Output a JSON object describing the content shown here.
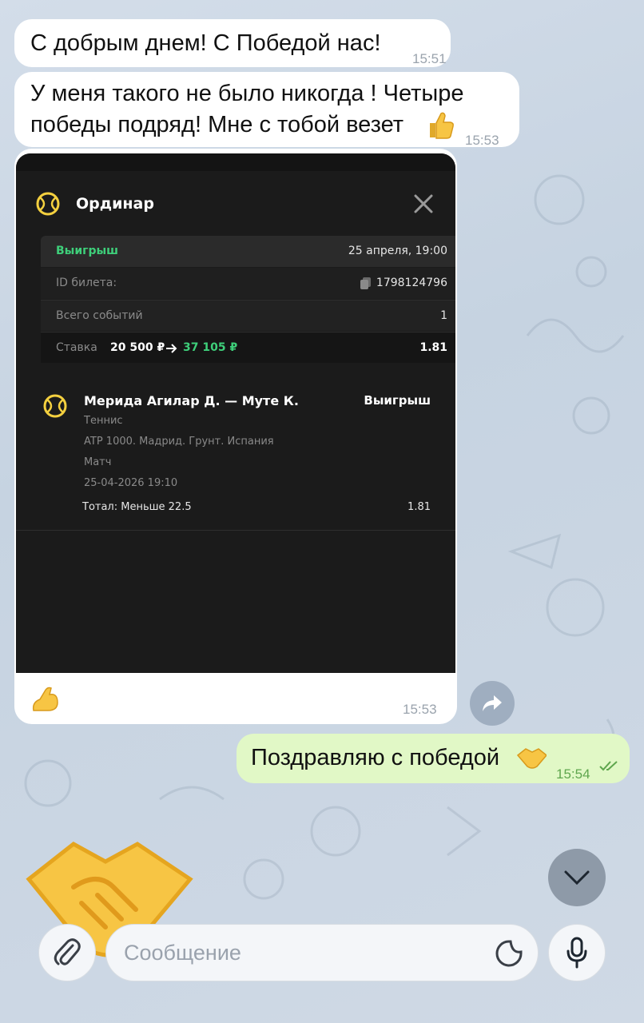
{
  "messages": {
    "m1": {
      "text": "С добрым днем! С Победой нас!",
      "time": "15:51"
    },
    "m2": {
      "line1": "У меня такого не было никогда ! Четыре",
      "line2": "победы подряд! Мне с тобой везет",
      "time": "15:53"
    },
    "photo_msg": {
      "time": "15:53"
    },
    "m4": {
      "text": "Поздравляю с победой",
      "time": "15:54"
    }
  },
  "ticket": {
    "title": "Ординар",
    "status": "Выигрыш",
    "date": "25 апреля, 19:00",
    "id_label": "ID билета:",
    "id_value": "1798124796",
    "events_label": "Всего событий",
    "events_value": "1",
    "stake_label": "Ставка",
    "stake_value": "20 500 ₽",
    "payout_value": "37 105 ₽",
    "odds": "1.81",
    "event": {
      "name": "Мерида Агилар Д. — Муте К.",
      "result": "Выигрыш",
      "sport": "Теннис",
      "tournament": "ATP 1000. Мадрид. Грунт. Испания",
      "type": "Матч",
      "datetime": "25-04-2026 19:10",
      "market": "Тотал: Меньше 22.5",
      "odds": "1.81"
    }
  },
  "composer": {
    "placeholder": "Сообщение"
  },
  "colors": {
    "incoming_bubble": "#ffffff",
    "outgoing_bubble": "#e1f8c6",
    "win_green": "#3ecf7a",
    "tennis_yellow": "#f4d03f",
    "card_bg": "#1b1b1b"
  },
  "icons": [
    "thumbs-up-emoji",
    "handshake-emoji",
    "flexed-biceps-emoji",
    "tennis-ball-icon",
    "close-icon",
    "copy-icon",
    "arrow-right-icon",
    "forward-icon",
    "double-check-icon",
    "chevron-down-icon",
    "paperclip-icon",
    "sticker-icon",
    "microphone-icon"
  ]
}
